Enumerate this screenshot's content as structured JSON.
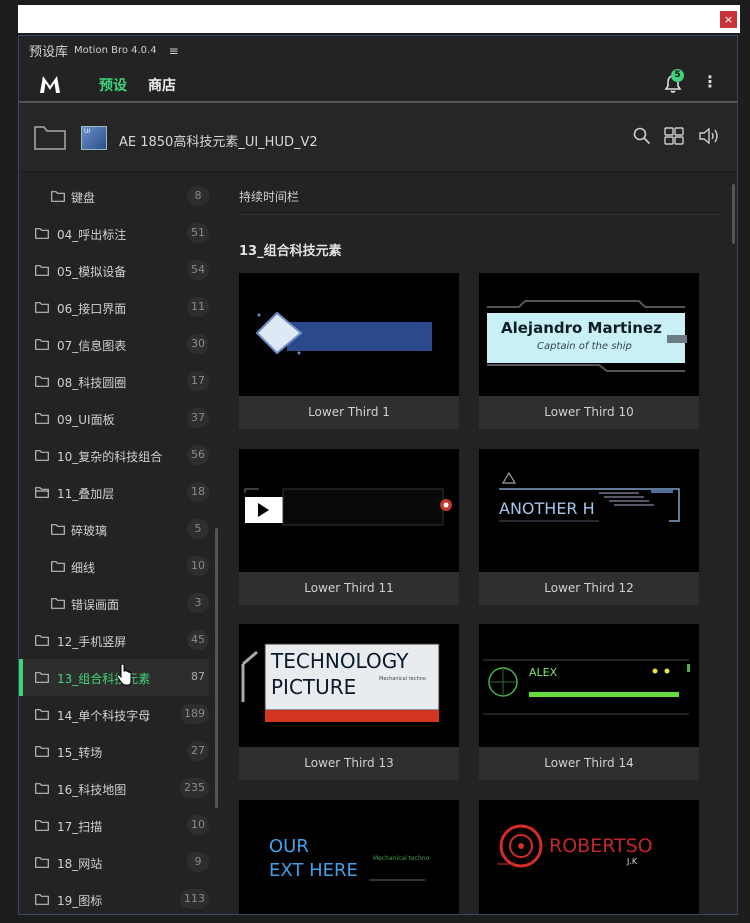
{
  "window": {
    "close_label": "×"
  },
  "panel": {
    "title": "预设库",
    "app_name": "Motion Bro 4.0.4",
    "menu_icon": "≡"
  },
  "header": {
    "tabs": [
      {
        "label": "预设"
      },
      {
        "label": "商店"
      }
    ],
    "notification_count": "5",
    "more_icon": "⋮"
  },
  "pathbar": {
    "preset_name": "AE 1850高科技元素_UI_HUD_V2",
    "thumb_label": "UI"
  },
  "sidebar": {
    "items": [
      {
        "label": "键盘",
        "count": "8"
      },
      {
        "label": "04_呼出标注",
        "count": "51"
      },
      {
        "label": "05_模拟设备",
        "count": "54"
      },
      {
        "label": "06_接口界面",
        "count": "11"
      },
      {
        "label": "07_信息图表",
        "count": "30"
      },
      {
        "label": "08_科技圆圈",
        "count": "17"
      },
      {
        "label": "09_UI面板",
        "count": "37"
      },
      {
        "label": "10_复杂的科技组合",
        "count": "56"
      },
      {
        "label": "11_叠加层",
        "count": "18"
      },
      {
        "label": "碎玻璃",
        "count": "5"
      },
      {
        "label": "细线",
        "count": "10"
      },
      {
        "label": "错误画面",
        "count": "3"
      },
      {
        "label": "12_手机竖屏",
        "count": "45"
      },
      {
        "label": "13_组合科技元素",
        "count": "87"
      },
      {
        "label": "14_单个科技字母",
        "count": "189"
      },
      {
        "label": "15_转场",
        "count": "27"
      },
      {
        "label": "16_科技地图",
        "count": "235"
      },
      {
        "label": "17_扫描",
        "count": "10"
      },
      {
        "label": "18_网站",
        "count": "9"
      },
      {
        "label": "19_图标",
        "count": "113"
      }
    ]
  },
  "main": {
    "section_label": "持续时间栏",
    "group_title": "13_组合科技元素",
    "cards": [
      {
        "caption": "Lower Third 1"
      },
      {
        "caption": "Lower Third 10",
        "pv_name": "Alejandro Martinez",
        "pv_sub": "Captain of the ship"
      },
      {
        "caption": "Lower Third 11"
      },
      {
        "caption": "Lower Third 12",
        "pv_text": "ANOTHER H"
      },
      {
        "caption": "Lower Third 13",
        "pv_line1": "TECHNOLOGY",
        "pv_line2": "PICTURE",
        "pv_small": "Mechanical techno"
      },
      {
        "caption": "Lower Third 14",
        "pv_text": "ALEX"
      },
      {
        "caption": "",
        "pv_line1": "OUR",
        "pv_line2": "EXT HERE",
        "pv_small": "Mechanical techno"
      },
      {
        "caption": "",
        "pv_name": "ROBERTSO",
        "pv_sub": "J.K"
      }
    ]
  },
  "colors": {
    "accent": "#3fd47a",
    "close": "#c8343a",
    "panel_bg": "#232323"
  }
}
